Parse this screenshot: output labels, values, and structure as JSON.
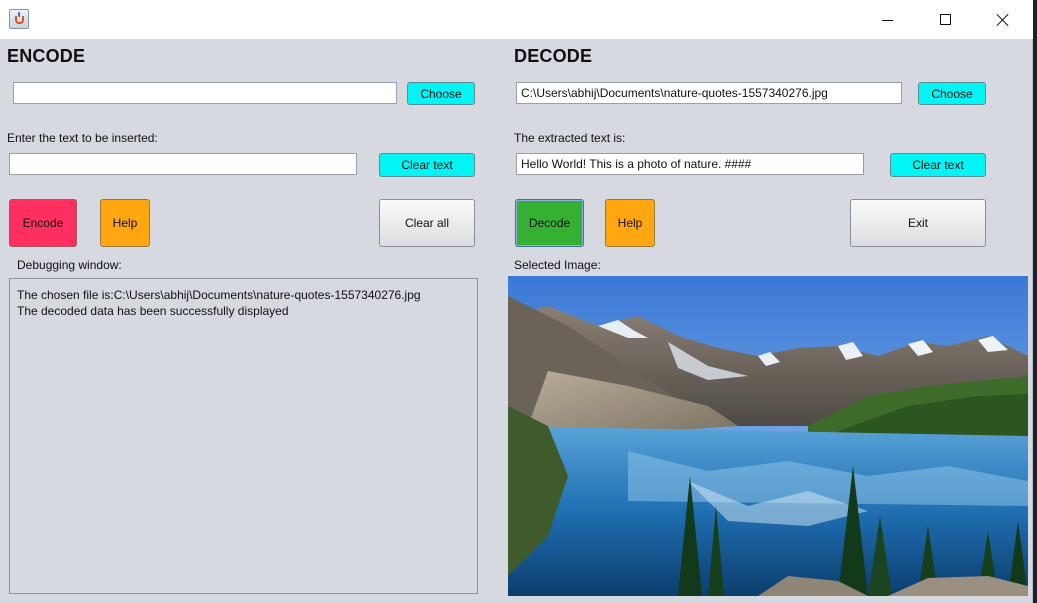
{
  "window": {
    "title": "",
    "controls": {
      "minimize": "minimize",
      "maximize": "maximize",
      "close": "close"
    }
  },
  "encode": {
    "heading": "ENCODE",
    "file_path": "",
    "choose_label": "Choose",
    "text_prompt": "Enter the text to be inserted:",
    "text_value": "",
    "clear_text_label": "Clear text",
    "encode_label": "Encode",
    "help_label": "Help",
    "clear_all_label": "Clear all",
    "debug_title": "Debugging window:",
    "debug_lines": [
      "The chosen file is:C:\\Users\\abhij\\Documents\\nature-quotes-1557340276.jpg",
      "The decoded data has been successfully displayed"
    ]
  },
  "decode": {
    "heading": "DECODE",
    "file_path": "C:\\Users\\abhij\\Documents\\nature-quotes-1557340276.jpg",
    "choose_label": "Choose",
    "extracted_prompt": "The extracted text is:",
    "extracted_value": "Hello World! This is a photo of nature. ####",
    "clear_text_label": "Clear text",
    "decode_label": "Decode",
    "help_label": "Help",
    "exit_label": "Exit",
    "image_title": "Selected Image:"
  },
  "colors": {
    "cyan_button": "#00f5f5",
    "encode_button": "#ff3060",
    "help_button": "#ffa610",
    "decode_button": "#36b032",
    "panel_background": "#d6d9e0"
  }
}
